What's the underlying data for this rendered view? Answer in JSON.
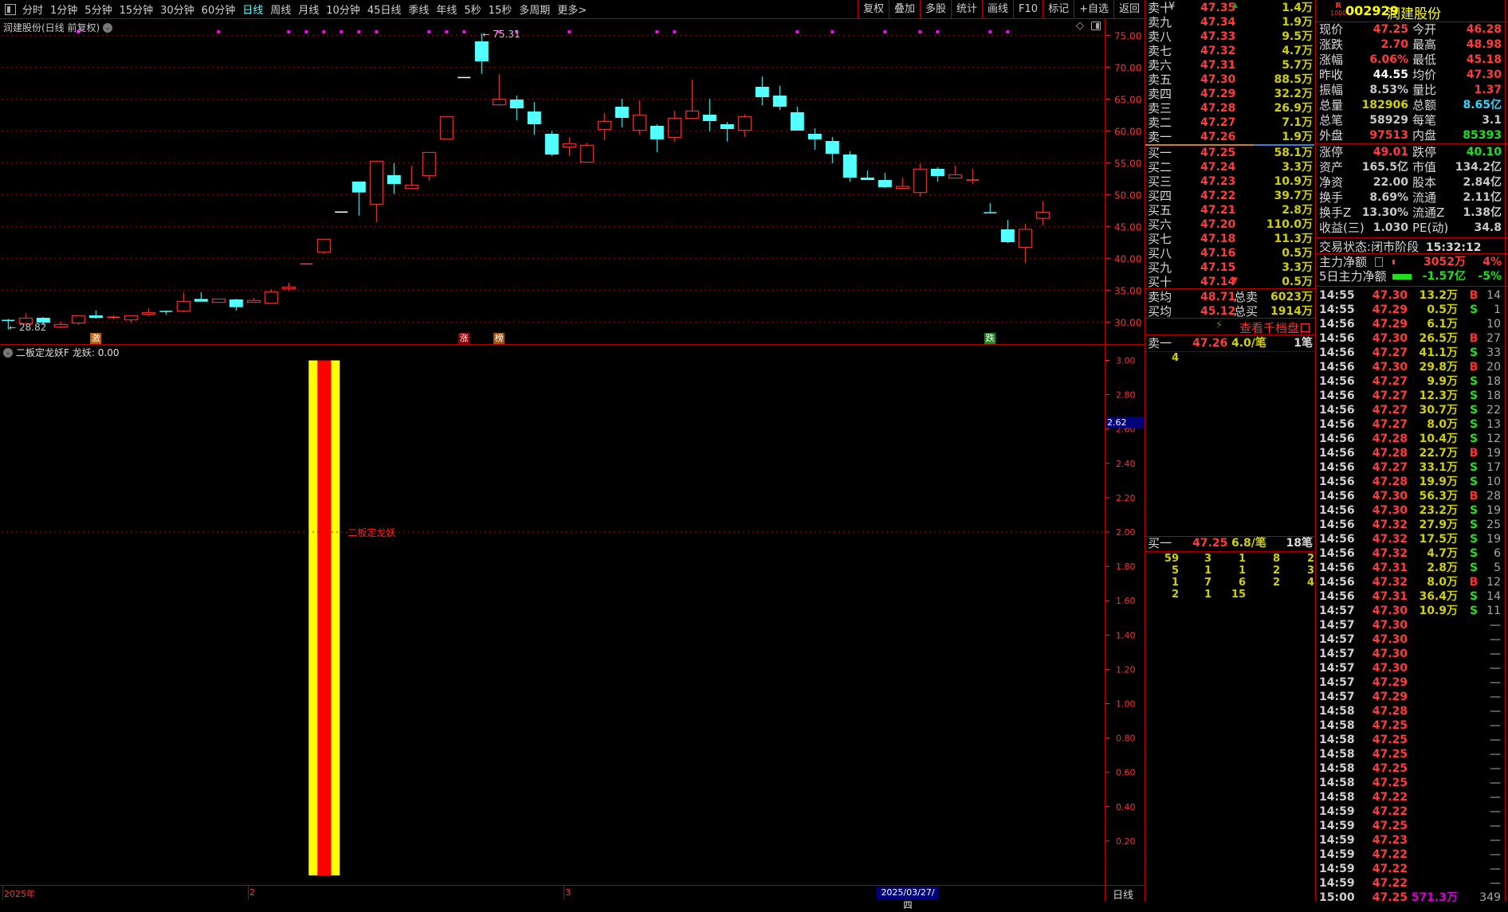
{
  "toolbar": {
    "periods": [
      "分时",
      "1分钟",
      "5分钟",
      "15分钟",
      "30分钟",
      "60分钟",
      "日线",
      "周线",
      "月线",
      "10分钟",
      "45日线",
      "季线",
      "年线",
      "5秒",
      "15秒",
      "多周期",
      "更多>"
    ],
    "active_period": "日线",
    "tools": [
      "复权",
      "叠加",
      "多股",
      "统计",
      "画线",
      "F10",
      "标记",
      "+自选",
      "返回"
    ]
  },
  "chart": {
    "title": "润建股份(日线 前复权)",
    "max_label": "75.31",
    "min_label": "28.82",
    "events": [
      {
        "day": 5,
        "text": "激",
        "color": "#c05a00"
      },
      {
        "day": 26,
        "text": "涨",
        "color": "#8b0000"
      },
      {
        "day": 28,
        "text": "榜",
        "color": "#a0520b"
      },
      {
        "day": 56,
        "text": "跌",
        "color": "#1d8a1d"
      }
    ],
    "x_labels": [
      {
        "day": 0,
        "text": "2025年"
      },
      {
        "day": 14,
        "text": "2"
      },
      {
        "day": 32,
        "text": "3"
      }
    ],
    "cursor_date": "2025/03/27/四",
    "period_label": "日线"
  },
  "indicator": {
    "name": "二板定龙妖F",
    "value_label": "龙妖: 0.00",
    "signal_label": "二板定龙妖",
    "current_value": "2.62"
  },
  "chart_data": [
    {
      "type": "candlestick",
      "ylim": [
        28,
        77
      ],
      "y_ticks": [
        "75.00",
        "70.00",
        "65.00",
        "60.00",
        "55.00",
        "50.00",
        "45.00",
        "40.00",
        "35.00",
        "30.00"
      ],
      "grid": true,
      "up_color": "#ff3b3b",
      "down_color": "#54ffff",
      "candles_ohlc": [
        [
          30.25,
          30.5,
          28.82,
          30.2
        ],
        [
          29.71,
          31.42,
          29.7,
          30.62
        ],
        [
          30.66,
          30.79,
          29.54,
          29.92
        ],
        [
          29.21,
          30.04,
          29.04,
          29.62
        ],
        [
          29.83,
          31.0,
          29.67,
          31.0
        ],
        [
          31.04,
          31.79,
          30.54,
          30.66
        ],
        [
          30.7,
          31.04,
          30.46,
          30.75
        ],
        [
          30.33,
          31.0,
          29.92,
          31.0
        ],
        [
          31.21,
          32.17,
          30.92,
          31.5
        ],
        [
          31.66,
          31.79,
          31.17,
          31.62
        ],
        [
          31.71,
          34.67,
          31.54,
          33.25
        ],
        [
          33.62,
          34.67,
          33.2,
          33.2
        ],
        [
          33.08,
          33.62,
          33.08,
          33.62
        ],
        [
          33.54,
          33.67,
          31.79,
          32.33
        ],
        [
          33.08,
          33.79,
          33.08,
          33.38
        ],
        [
          32.96,
          35.17,
          32.96,
          34.75
        ],
        [
          35.2,
          36.17,
          34.92,
          35.5
        ],
        [
          39.1,
          39.12,
          39.1,
          39.12
        ],
        [
          40.96,
          43.0,
          40.75,
          43.0
        ],
        [
          47.25,
          47.25,
          47.25,
          47.25
        ],
        [
          52.04,
          52.04,
          46.71,
          50.33
        ],
        [
          48.5,
          55.25,
          45.67,
          55.25
        ],
        [
          53.04,
          54.92,
          50.08,
          51.67
        ],
        [
          50.96,
          54.5,
          50.96,
          51.5
        ],
        [
          52.96,
          56.62,
          52.2,
          56.62
        ],
        [
          58.71,
          62.25,
          58.71,
          62.25
        ],
        [
          68.37,
          68.37,
          68.37,
          68.37
        ],
        [
          74.04,
          75.31,
          68.96,
          70.92
        ],
        [
          64.08,
          68.92,
          63.96,
          65.0
        ],
        [
          64.92,
          65.54,
          61.67,
          63.54
        ],
        [
          63.04,
          64.54,
          59.4,
          61.04
        ],
        [
          59.54,
          60.0,
          56.08,
          56.29
        ],
        [
          57.46,
          59.0,
          56.04,
          58.0
        ],
        [
          55.08,
          58.12,
          55.08,
          57.75
        ],
        [
          60.2,
          62.79,
          58.54,
          61.5
        ],
        [
          63.79,
          65.04,
          60.54,
          62.04
        ],
        [
          60.08,
          64.79,
          59.4,
          62.5
        ],
        [
          60.79,
          61.04,
          56.67,
          58.67
        ],
        [
          58.96,
          63.17,
          58.29,
          62.0
        ],
        [
          61.96,
          68.04,
          61.96,
          63.12
        ],
        [
          62.54,
          65.04,
          59.92,
          61.54
        ],
        [
          61.04,
          61.41,
          58.33,
          60.29
        ],
        [
          60.08,
          62.62,
          59.04,
          62.25
        ],
        [
          66.92,
          68.54,
          64.04,
          65.29
        ],
        [
          65.54,
          67.04,
          63.29,
          63.79
        ],
        [
          62.92,
          63.79,
          60.04,
          60.04
        ],
        [
          59.54,
          60.41,
          57.04,
          58.67
        ],
        [
          58.41,
          59.04,
          54.92,
          56.41
        ],
        [
          56.29,
          56.79,
          52.04,
          52.67
        ],
        [
          52.67,
          53.79,
          52.29,
          52.29
        ],
        [
          52.29,
          53.41,
          51.04,
          51.17
        ],
        [
          50.96,
          52.66,
          50.96,
          51.29
        ],
        [
          50.33,
          54.91,
          49.71,
          54.0
        ],
        [
          54.04,
          54.29,
          52.04,
          52.91
        ],
        [
          52.58,
          54.54,
          52.58,
          53.12
        ],
        [
          52.12,
          54.04,
          51.66,
          52.29
        ],
        [
          47.14,
          48.66,
          47.12,
          47.12
        ],
        [
          44.54,
          46.04,
          42.41,
          42.54
        ],
        [
          41.71,
          45.41,
          39.29,
          44.55
        ],
        [
          46.28,
          48.98,
          45.18,
          47.25
        ]
      ],
      "marker_days": [
        4,
        12,
        16,
        17,
        18,
        19,
        20,
        21,
        24,
        25,
        26,
        28,
        29,
        32,
        37,
        38,
        45,
        47,
        50,
        52,
        53,
        56,
        57
      ],
      "marker_color": "#ff00ff"
    },
    {
      "type": "bar",
      "ylim": [
        0,
        3.0
      ],
      "y_ticks": [
        "3.00",
        "2.80",
        "2.60",
        "2.40",
        "2.20",
        "2.00",
        "1.80",
        "1.60",
        "1.40",
        "1.20",
        "1.00",
        "0.80",
        "0.60",
        "0.40",
        "0.20"
      ],
      "bar_day": 18,
      "bar_value": 3.0,
      "signal_level": 2.0,
      "colors": [
        "#ffff00",
        "#ff0000"
      ]
    }
  ],
  "orderbook": {
    "asks": [
      {
        "label": "卖十",
        "price": "47.35",
        "vol": "1.4万"
      },
      {
        "label": "卖九",
        "price": "47.34",
        "vol": "1.9万"
      },
      {
        "label": "卖八",
        "price": "47.33",
        "vol": "9.5万"
      },
      {
        "label": "卖七",
        "price": "47.32",
        "vol": "4.7万"
      },
      {
        "label": "卖六",
        "price": "47.31",
        "vol": "5.7万"
      },
      {
        "label": "卖五",
        "price": "47.30",
        "vol": "88.5万"
      },
      {
        "label": "卖四",
        "price": "47.29",
        "vol": "32.2万"
      },
      {
        "label": "卖三",
        "price": "47.28",
        "vol": "26.9万"
      },
      {
        "label": "卖二",
        "price": "47.27",
        "vol": "7.1万"
      },
      {
        "label": "卖一",
        "price": "47.26",
        "vol": "1.9万"
      }
    ],
    "ask_currency": "¥",
    "bids": [
      {
        "label": "买一",
        "price": "47.25",
        "vol": "58.1万"
      },
      {
        "label": "买二",
        "price": "47.24",
        "vol": "3.3万"
      },
      {
        "label": "买三",
        "price": "47.23",
        "vol": "10.9万"
      },
      {
        "label": "买四",
        "price": "47.22",
        "vol": "39.7万"
      },
      {
        "label": "买五",
        "price": "47.21",
        "vol": "2.8万"
      },
      {
        "label": "买六",
        "price": "47.20",
        "vol": "110.0万"
      },
      {
        "label": "买七",
        "price": "47.18",
        "vol": "11.3万"
      },
      {
        "label": "买八",
        "price": "47.16",
        "vol": "0.5万"
      },
      {
        "label": "买九",
        "price": "47.15",
        "vol": "3.3万"
      },
      {
        "label": "买十",
        "price": "47.14",
        "vol": "0.5万"
      }
    ],
    "avg_ask": {
      "label": "卖均",
      "price": "48.71",
      "label2": "总卖",
      "vol": "6023万"
    },
    "avg_bid": {
      "label": "买均",
      "price": "45.12",
      "label2": "总买",
      "vol": "1914万"
    },
    "depth_link": "查看千档盘口",
    "ask1": {
      "label": "卖一",
      "price": "47.26",
      "per": "4.0/笔",
      "count": "1笔",
      "orders": [
        "4"
      ]
    },
    "bid1": {
      "label": "买一",
      "price": "47.25",
      "per": "6.8/笔",
      "count": "18笔",
      "orders": [
        [
          "59",
          "3",
          "1",
          "8",
          "2"
        ],
        [
          "5",
          "1",
          "1",
          "2",
          "3"
        ],
        [
          "1",
          "7",
          "6",
          "2",
          "4"
        ],
        [
          "2",
          "1",
          "15",
          "",
          ""
        ]
      ]
    }
  },
  "quote": {
    "badge_top": "R",
    "badge_bottom": "1000",
    "code": "002929",
    "name": "润建股份",
    "rows": [
      [
        "现价",
        "47.25",
        "#ff3b3b",
        "今开",
        "46.28",
        "#ff3b3b"
      ],
      [
        "涨跌",
        "2.70",
        "#ff3b3b",
        "最高",
        "48.98",
        "#ff3b3b"
      ],
      [
        "涨幅",
        "6.06%",
        "#ff3b3b",
        "最低",
        "45.18",
        "#ff3b3b"
      ],
      [
        "昨收",
        "44.55",
        "#ffffff",
        "均价",
        "47.30",
        "#ff3b3b"
      ],
      [
        "振幅",
        "8.53%",
        "#c8c8c8",
        "量比",
        "1.37",
        "#ff3b3b"
      ],
      [
        "总量",
        "182906",
        "#d0d000",
        "总额",
        "8.65亿",
        "#34d8ff"
      ],
      [
        "总笔",
        "58929",
        "#c8c8c8",
        "每笔",
        "3.1",
        "#c8c8c8"
      ],
      [
        "外盘",
        "97513",
        "#ff3b3b",
        "内盘",
        "85393",
        "#20e020"
      ]
    ],
    "rows2": [
      [
        "涨停",
        "49.01",
        "#ff3b3b",
        "跌停",
        "40.10",
        "#20e020"
      ],
      [
        "资产",
        "165.5亿",
        "#c8c8c8",
        "市值",
        "134.2亿",
        "#c8c8c8"
      ],
      [
        "净资",
        "22.00",
        "#c8c8c8",
        "股本",
        "2.84亿",
        "#c8c8c8"
      ],
      [
        "换手",
        "8.69%",
        "#c8c8c8",
        "流通",
        "2.11亿",
        "#c8c8c8"
      ],
      [
        "换手Z",
        "13.30%",
        "#c8c8c8",
        "流通Z",
        "1.38亿",
        "#c8c8c8"
      ],
      [
        "收益(三)",
        "1.030",
        "#c8c8c8",
        "PE(动)",
        "34.8",
        "#c8c8c8"
      ]
    ],
    "status_label": "交易状态:",
    "status": "闭市阶段",
    "time": "15:32:12",
    "flow": [
      {
        "label": "主力净额",
        "value": "3052万",
        "pct": "4%",
        "color": "#ff3b3b",
        "bar": 0.05
      },
      {
        "label": "5日主力净额",
        "value": "-1.57亿",
        "pct": "-5%",
        "color": "#20e020",
        "bar": 1.0
      }
    ]
  },
  "ticks": [
    [
      "14:55",
      "47.30",
      "13.2万",
      "B",
      "14"
    ],
    [
      "14:55",
      "47.29",
      "0.5万",
      "S",
      "1"
    ],
    [
      "14:56",
      "47.29",
      "6.1万",
      "",
      "10"
    ],
    [
      "14:56",
      "47.30",
      "26.5万",
      "B",
      "27"
    ],
    [
      "14:56",
      "47.27",
      "41.1万",
      "S",
      "33"
    ],
    [
      "14:56",
      "47.30",
      "29.8万",
      "B",
      "20"
    ],
    [
      "14:56",
      "47.27",
      "9.9万",
      "S",
      "18"
    ],
    [
      "14:56",
      "47.27",
      "12.3万",
      "S",
      "18"
    ],
    [
      "14:56",
      "47.27",
      "30.7万",
      "S",
      "22"
    ],
    [
      "14:56",
      "47.27",
      "8.0万",
      "S",
      "13"
    ],
    [
      "14:56",
      "47.28",
      "10.4万",
      "S",
      "12"
    ],
    [
      "14:56",
      "47.28",
      "22.7万",
      "B",
      "19"
    ],
    [
      "14:56",
      "47.27",
      "33.1万",
      "S",
      "17"
    ],
    [
      "14:56",
      "47.28",
      "19.9万",
      "S",
      "10"
    ],
    [
      "14:56",
      "47.30",
      "56.3万",
      "B",
      "28"
    ],
    [
      "14:56",
      "47.30",
      "23.2万",
      "S",
      "19"
    ],
    [
      "14:56",
      "47.32",
      "27.9万",
      "S",
      "25"
    ],
    [
      "14:56",
      "47.32",
      "17.5万",
      "S",
      "19"
    ],
    [
      "14:56",
      "47.32",
      "4.7万",
      "S",
      "6"
    ],
    [
      "14:56",
      "47.31",
      "2.8万",
      "S",
      "5"
    ],
    [
      "14:56",
      "47.32",
      "8.0万",
      "B",
      "12"
    ],
    [
      "14:56",
      "47.31",
      "36.4万",
      "S",
      "14"
    ],
    [
      "14:57",
      "47.30",
      "10.9万",
      "S",
      "11"
    ],
    [
      "14:57",
      "47.30",
      "",
      "",
      "—"
    ],
    [
      "14:57",
      "47.30",
      "",
      "",
      "—"
    ],
    [
      "14:57",
      "47.30",
      "",
      "",
      "—"
    ],
    [
      "14:57",
      "47.30",
      "",
      "",
      "—"
    ],
    [
      "14:57",
      "47.29",
      "",
      "",
      "—"
    ],
    [
      "14:57",
      "47.29",
      "",
      "",
      "—"
    ],
    [
      "14:58",
      "47.28",
      "",
      "",
      "—"
    ],
    [
      "14:58",
      "47.25",
      "",
      "",
      "—"
    ],
    [
      "14:58",
      "47.25",
      "",
      "",
      "—"
    ],
    [
      "14:58",
      "47.25",
      "",
      "",
      "—"
    ],
    [
      "14:58",
      "47.25",
      "",
      "",
      "—"
    ],
    [
      "14:58",
      "47.25",
      "",
      "",
      "—"
    ],
    [
      "14:58",
      "47.22",
      "",
      "",
      "—"
    ],
    [
      "14:59",
      "47.22",
      "",
      "",
      "—"
    ],
    [
      "14:59",
      "47.25",
      "",
      "",
      "—"
    ],
    [
      "14:59",
      "47.23",
      "",
      "",
      "—"
    ],
    [
      "14:59",
      "47.22",
      "",
      "",
      "—"
    ],
    [
      "14:59",
      "47.22",
      "",
      "",
      "—"
    ],
    [
      "14:59",
      "47.22",
      "",
      "",
      "—"
    ],
    [
      "15:00",
      "47.25",
      "571.3万",
      "",
      "349"
    ]
  ]
}
